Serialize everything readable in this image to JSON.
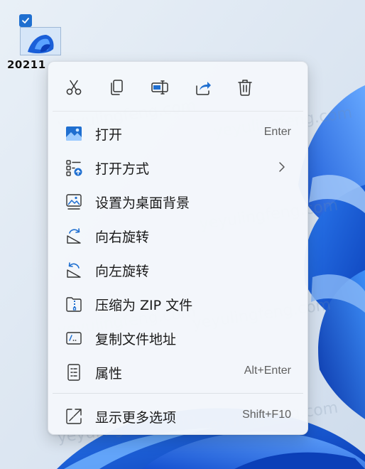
{
  "desktop": {
    "file": {
      "label": "20211",
      "selected": true
    },
    "watermark": "yeyulingfeng.com",
    "colors": {
      "accent": "#1f6fd0",
      "wallpaper_blue": "#1a5fd8"
    }
  },
  "menu": {
    "toolbar": [
      {
        "name": "cut",
        "icon": "scissors-icon"
      },
      {
        "name": "copy",
        "icon": "copy-icon"
      },
      {
        "name": "rename",
        "icon": "rename-icon"
      },
      {
        "name": "share",
        "icon": "share-icon"
      },
      {
        "name": "delete",
        "icon": "trash-icon"
      }
    ],
    "items": [
      {
        "label": "打开",
        "shortcut": "Enter",
        "icon": "image-file-icon"
      },
      {
        "label": "打开方式",
        "shortcut": "",
        "icon": "open-with-icon",
        "submenu": true
      },
      {
        "label": "设置为桌面背景",
        "shortcut": "",
        "icon": "set-wallpaper-icon"
      },
      {
        "label": "向右旋转",
        "shortcut": "",
        "icon": "rotate-right-icon"
      },
      {
        "label": "向左旋转",
        "shortcut": "",
        "icon": "rotate-left-icon"
      },
      {
        "label": "压缩为 ZIP 文件",
        "shortcut": "",
        "icon": "zip-folder-icon"
      },
      {
        "label": "复制文件地址",
        "shortcut": "",
        "icon": "copy-path-icon"
      },
      {
        "label": "属性",
        "shortcut": "Alt+Enter",
        "icon": "properties-icon"
      }
    ],
    "more": {
      "label": "显示更多选项",
      "shortcut": "Shift+F10",
      "icon": "show-more-icon"
    }
  }
}
